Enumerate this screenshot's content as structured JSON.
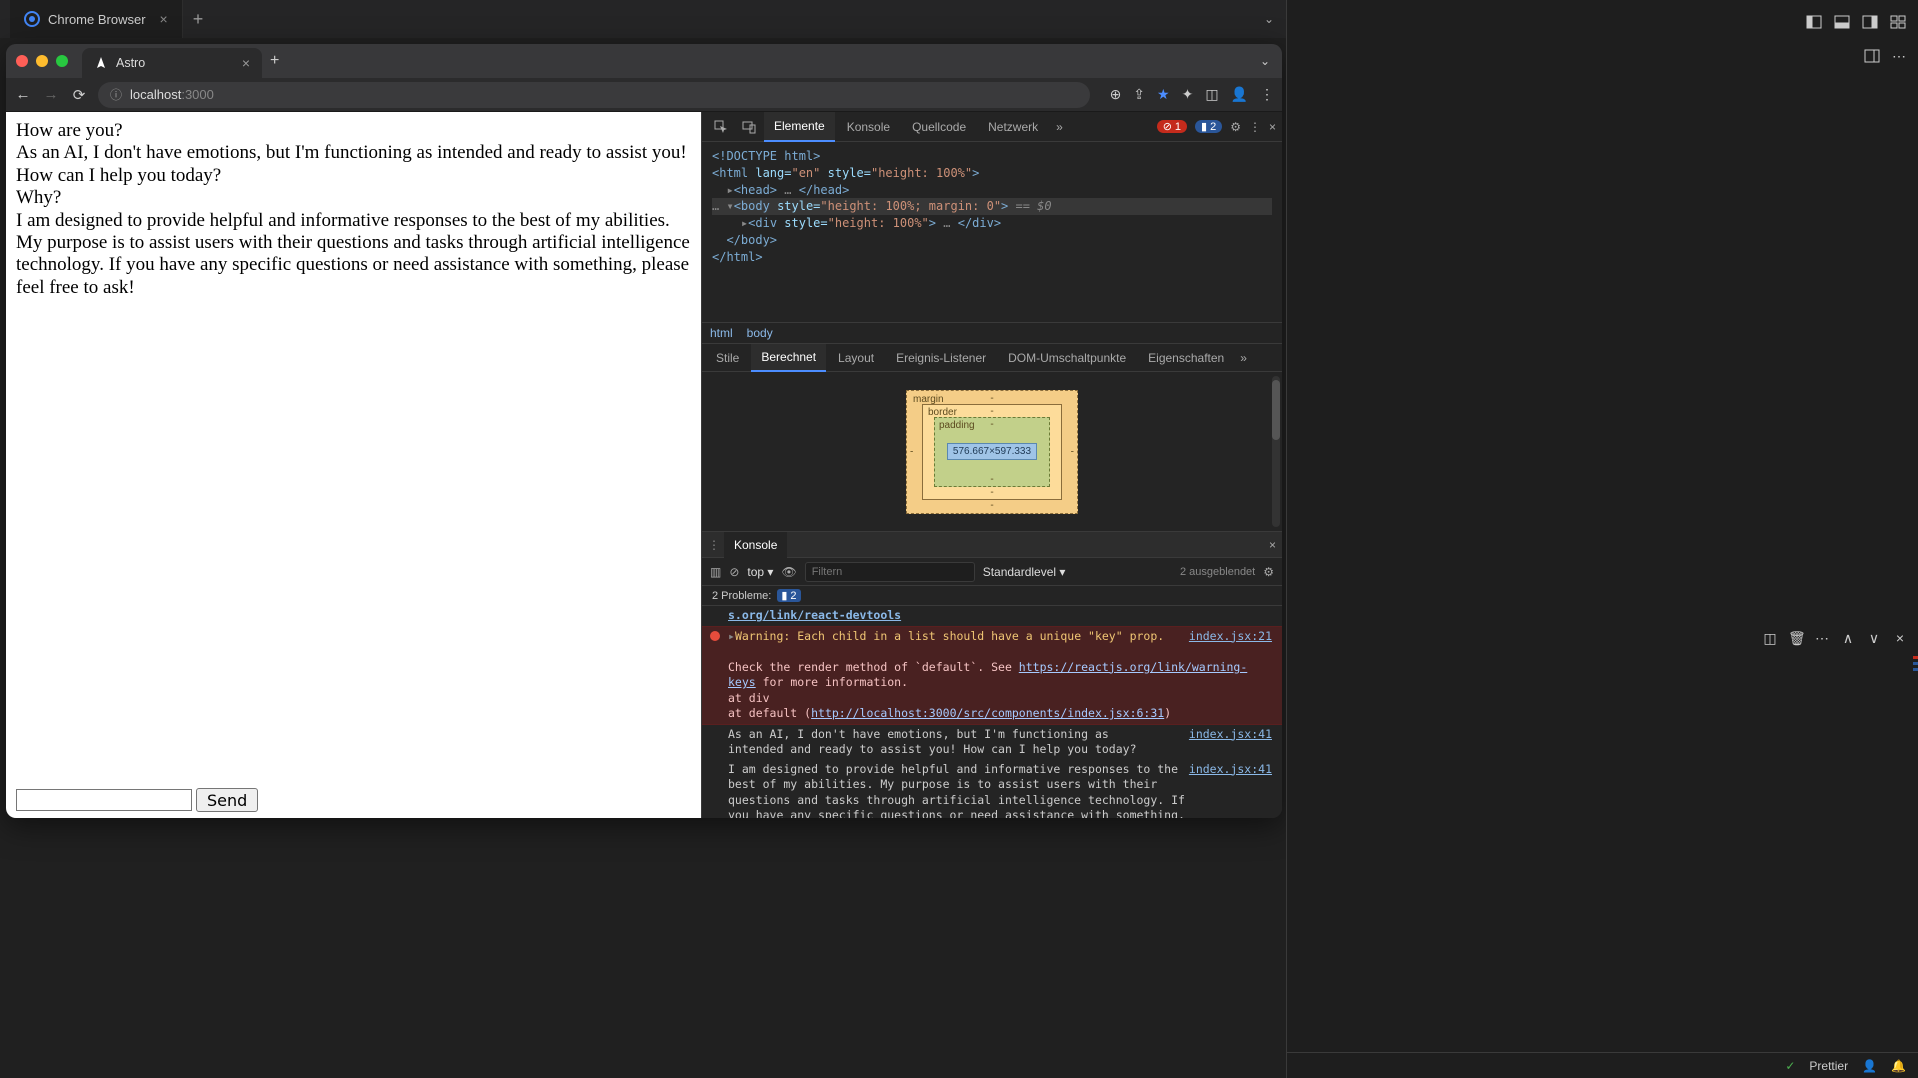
{
  "editor": {
    "outer_tab": {
      "label": "Chrome Browser"
    }
  },
  "browser": {
    "tab": {
      "label": "Astro"
    },
    "omnibox": {
      "host": "localhost",
      "path": ":3000"
    }
  },
  "chat": {
    "q1": "How are you?",
    "a1": "As an AI, I don't have emotions, but I'm functioning as intended and ready to assist you! How can I help you today?",
    "q2": "Why?",
    "a2": "I am designed to provide helpful and informative responses to the best of my abilities. My purpose is to assist users with their questions and tasks through artificial intelligence technology. If you have any specific questions or need assistance with something, please feel free to ask!",
    "send": "Send"
  },
  "devtools": {
    "tabs": {
      "elements": "Elemente",
      "console": "Konsole",
      "sources": "Quellcode",
      "network": "Netzwerk"
    },
    "err_count": "1",
    "msg_count": "2",
    "dom": {
      "doctype": "<!DOCTYPE html>",
      "html_open": "<html lang=\"en\" style=\"height: 100%\">",
      "head": "<head> … </head>",
      "body_open": "<body style=\"height: 100%; margin: 0\">",
      "eq0": " == $0",
      "div": "<div style=\"height: 100%\"> … </div>",
      "body_close": "</body>",
      "html_close": "</html>"
    },
    "breadcrumb": {
      "a": "html",
      "b": "body"
    },
    "styles_tabs": {
      "styles": "Stile",
      "computed": "Berechnet",
      "layout": "Layout",
      "listeners": "Ereignis-Listener",
      "dom_bp": "DOM-Umschaltpunkte",
      "props": "Eigenschaften"
    },
    "boxmodel": {
      "margin": "margin",
      "border": "border",
      "padding": "padding",
      "content": "576.667×597.333"
    },
    "console": {
      "title": "Konsole",
      "context": "top",
      "filter_placeholder": "Filtern",
      "level": "Standardlevel",
      "hidden": "2 ausgeblendet",
      "problems_label": "2 Probleme:",
      "problems_badge": "2",
      "link_top": "s.org/link/react-devtools",
      "err_src": "index.jsx:21",
      "err_head": "Warning: Each child in a list should have a unique \"key\" prop.",
      "err_l2a": "Check the render method of `default`. See ",
      "err_l2b": "https://reactjs.org/link/warning-keys",
      "err_l2c": " for more information.",
      "err_l3": "    at div",
      "err_l4a": "    at default (",
      "err_l4b": "http://localhost:3000/src/components/index.jsx:6:31",
      "err_l4c": ")",
      "log1_src": "index.jsx:41",
      "log1": "As an AI, I don't have emotions, but I'm functioning as intended and ready to assist you! How can I help you today?",
      "log2_src": "index.jsx:41",
      "log2": "I am designed to provide helpful and informative responses to the best of my abilities. My purpose is to assist users with their questions and tasks through artificial intelligence technology. If you have any specific questions or need assistance with something, please feel free to ask!"
    }
  },
  "statusbar": {
    "prettier": "Prettier"
  }
}
